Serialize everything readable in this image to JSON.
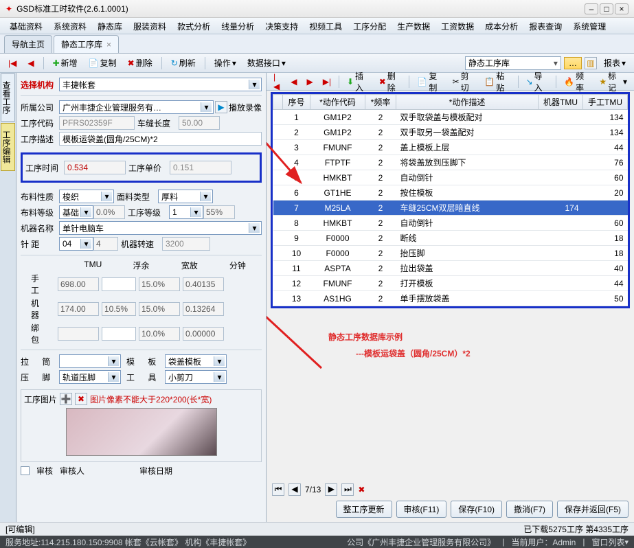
{
  "window": {
    "title": "GSD标准工时软件(2.6.1.0001)"
  },
  "menu": [
    "基础资料",
    "系统资料",
    "静态库",
    "服装资料",
    "款式分析",
    "线量分析",
    "决策支持",
    "视频工具",
    "工序分配",
    "生产数据",
    "工资数据",
    "成本分析",
    "报表查询",
    "系统管理"
  ],
  "tabs": {
    "nav": "导航主页",
    "active": "静态工序库"
  },
  "toolbar": {
    "new": "新增",
    "copy": "复制",
    "del": "删除",
    "refresh": "刷新",
    "op": "操作",
    "dataif": "数据接口",
    "libcombo": "静态工序库",
    "report": "报表"
  },
  "side": {
    "view": "查看工序",
    "edit": "工序编辑"
  },
  "left": {
    "select_org_lbl": "选择机构",
    "select_org_val": "丰捷帐套",
    "company_lbl": "所属公司",
    "company_val": "广州丰捷企业管理服务有…",
    "play_label": "播放录像",
    "code_lbl": "工序代码",
    "code_val": "PFRS02359F",
    "seam_lbl": "车缝长度",
    "seam_val": "50.00",
    "desc_lbl": "工序描述",
    "desc_val": "模板运袋盖(圆角/25CM)*2",
    "time_lbl": "工序时间",
    "time_val": "0.534",
    "price_lbl": "工序单价",
    "price_val": "0.151",
    "fabric_lbl": "布料性质",
    "fabric_val": "梭织",
    "surface_lbl": "面料类型",
    "surface_val": "厚料",
    "grade_lbl": "布料等级",
    "grade_val": "基础",
    "grade_pct": "0.0%",
    "opgrade_lbl": "工序等级",
    "opgrade_val": "1",
    "opgrade_pct": "55%",
    "machine_lbl": "机器名称",
    "machine_val": "单针电脑车",
    "needle_lbl": "针    距",
    "needle_val": "04",
    "needle_count": "4",
    "speed_lbl": "机器转速",
    "speed_val": "3200",
    "head": {
      "tmu": "TMU",
      "float": "浮余",
      "kuanfang": "宽放",
      "min": "分钟"
    },
    "hand_lbl": "手    工",
    "hand_tmu": "698.00",
    "hand_k": "15.0%",
    "hand_min": "0.40135",
    "mc_lbl": "机    器",
    "mc_tmu": "174.00",
    "mc_f": "10.5%",
    "mc_k": "15.0%",
    "mc_min": "0.13264",
    "bind_lbl": "绑    包",
    "bind_k": "10.0%",
    "bind_min": "0.00000",
    "latong_lbl": "拉    筒",
    "latong_val": "",
    "moban_lbl": "模    板",
    "moban_val": "袋盖模板",
    "foot_lbl": "压    脚",
    "foot_val": "轨道压脚",
    "tool_lbl": "工    具",
    "tool_val": "小剪刀",
    "pic_lbl": "工序图片",
    "pic_note": "图片像素不能大于220*200(长*宽)",
    "audit_chk": "审核",
    "auditor_lbl": "审核人",
    "audit_date_lbl": "审核日期"
  },
  "rtool": {
    "insert": "插入",
    "del": "删除",
    "copy": "复制",
    "cut": "剪切",
    "paste": "粘贴",
    "import": "导入",
    "freq": "频率",
    "mark": "标记"
  },
  "gridhead": {
    "seq": "序号",
    "code": "*动作代码",
    "freq": "*频率",
    "desc": "*动作描述",
    "mtmu": "机器TMU",
    "htmu": "手工TMU"
  },
  "rows": [
    {
      "seq": 1,
      "code": "GM1P2",
      "freq": 2,
      "desc": "双手取袋盖与模板配对",
      "mtmu": "",
      "htmu": 134
    },
    {
      "seq": 2,
      "code": "GM1P2",
      "freq": 2,
      "desc": "双手取另一袋盖配对",
      "mtmu": "",
      "htmu": 134
    },
    {
      "seq": 3,
      "code": "FMUNF",
      "freq": 2,
      "desc": "盖上模板上层",
      "mtmu": "",
      "htmu": 44
    },
    {
      "seq": 4,
      "code": "FTPTF",
      "freq": 2,
      "desc": "将袋盖放到压脚下",
      "mtmu": "",
      "htmu": 76
    },
    {
      "seq": 5,
      "code": "HMKBT",
      "freq": 2,
      "desc": "自动倒针",
      "mtmu": "",
      "htmu": 60
    },
    {
      "seq": 6,
      "code": "GT1HE",
      "freq": 2,
      "desc": "按住模板",
      "mtmu": "",
      "htmu": 20
    },
    {
      "seq": 7,
      "code": "M25LA",
      "freq": 2,
      "desc": "车缝25CM双层暗直线",
      "mtmu": 174,
      "htmu": "",
      "sel": true
    },
    {
      "seq": 8,
      "code": "HMKBT",
      "freq": 2,
      "desc": "自动倒针",
      "mtmu": "",
      "htmu": 60
    },
    {
      "seq": 9,
      "code": "F0000",
      "freq": 2,
      "desc": "断线",
      "mtmu": "",
      "htmu": 18
    },
    {
      "seq": 10,
      "code": "F0000",
      "freq": 2,
      "desc": "抬压脚",
      "mtmu": "",
      "htmu": 18
    },
    {
      "seq": 11,
      "code": "ASPTA",
      "freq": 2,
      "desc": "拉出袋盖",
      "mtmu": "",
      "htmu": 40
    },
    {
      "seq": 12,
      "code": "FMUNF",
      "freq": 2,
      "desc": "打开模板",
      "mtmu": "",
      "htmu": 44
    },
    {
      "seq": 13,
      "code": "AS1HG",
      "freq": 2,
      "desc": "单手摆放袋盖",
      "mtmu": "",
      "htmu": 50
    }
  ],
  "note1": "静态工序数据库示例",
  "note2": "---模板运袋盖（圆角/25CM）*2",
  "pager": "7/13",
  "buttons": {
    "upd": "整工序更新",
    "audit": "审核(F11)",
    "save": "保存(F10)",
    "cancel": "撤消(F7)",
    "saveback": "保存并返回(F5)"
  },
  "status": {
    "left": "[可编辑]",
    "right": "已下载5275工序 第4335工序"
  },
  "footer": {
    "addr": "服务地址:114.215.180.150:9908  帐套《云帐套》 机构《丰捷帐套》",
    "company": "公司《广州丰捷企业管理服务有限公司》",
    "user": "当前用户：Admin",
    "wnd": "窗口列表"
  }
}
